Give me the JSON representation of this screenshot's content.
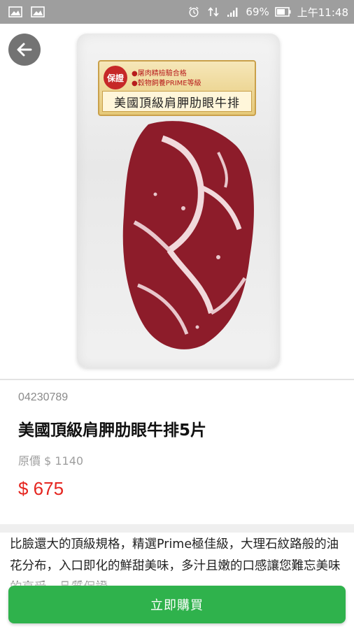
{
  "status_bar": {
    "battery": "69%",
    "time": "上午11:48"
  },
  "product_image": {
    "label_badge": "保證",
    "label_line1": "●屠肉精檢驗合格",
    "label_line2": "●穀物飼養PRIME等級",
    "label_title": "美國頂級肩胛肋眼牛排"
  },
  "product": {
    "code": "04230789",
    "name": "美國頂級肩胛肋眼牛排5片",
    "original_price": "原價 $ 1140",
    "sale_price": "$ 675",
    "description": "比臉還大的頂級規格，精選Prime極佳級，大理石紋路般的油花分布，入口即化的鮮甜美味，多汁且嫩的口感讓您難忘美味的享受，品質保證。"
  },
  "buy_button": {
    "label": "立即購買"
  },
  "colors": {
    "price_red": "#e52620",
    "buy_green": "#2fb24c",
    "status_gray": "#9e9e9e"
  }
}
